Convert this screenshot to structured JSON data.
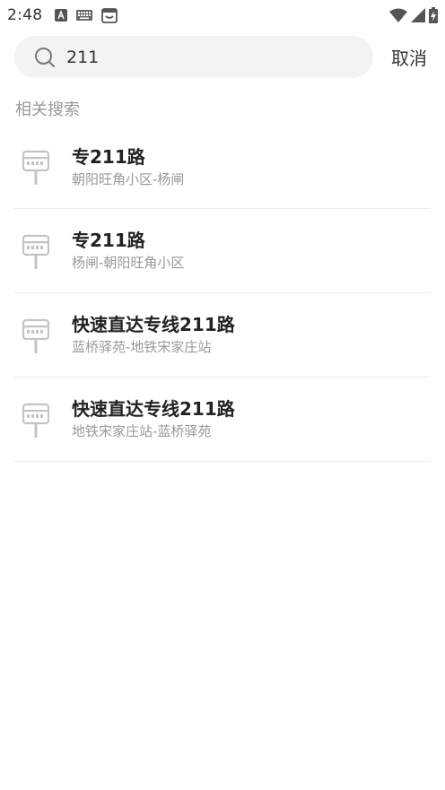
{
  "status_bar": {
    "time": "2:48"
  },
  "search": {
    "value": "211",
    "placeholder": "",
    "cancel_label": "取消"
  },
  "section_title": "相关搜索",
  "results": [
    {
      "name": "专211路",
      "route": "朝阳旺角小区-杨闸"
    },
    {
      "name": "专211路",
      "route": "杨闸-朝阳旺角小区"
    },
    {
      "name": "快速直达专线211路",
      "route": "蓝桥驿苑-地铁宋家庄站"
    },
    {
      "name": "快速直达专线211路",
      "route": "地铁宋家庄站-蓝桥驿苑"
    }
  ],
  "colors": {
    "icon_gray": "#c4c4c4",
    "search_bg": "#f3f3f3"
  }
}
